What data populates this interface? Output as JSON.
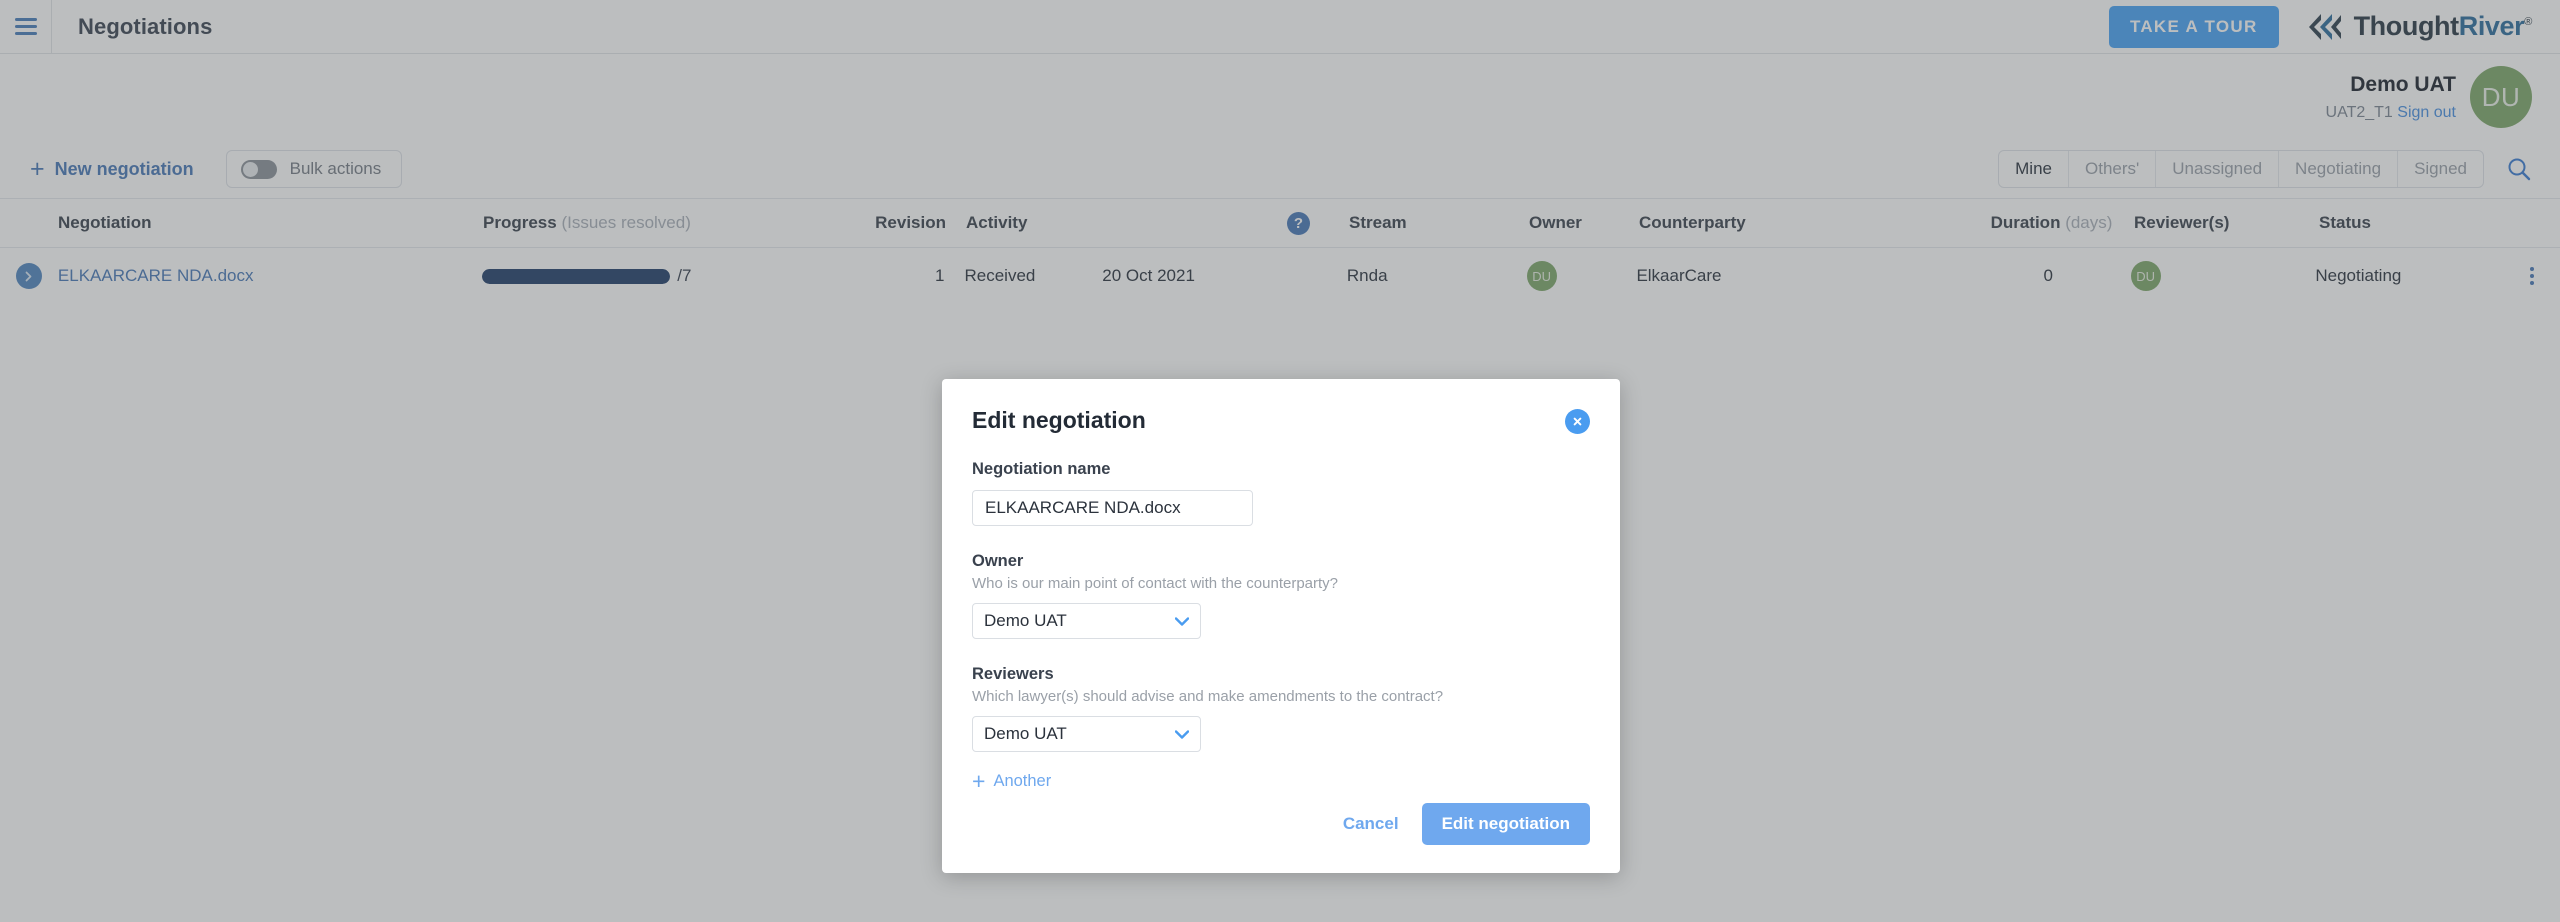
{
  "topbar": {
    "menu_icon": "hamburger-icon",
    "title": "Negotiations",
    "tour_button": "TAKE A TOUR",
    "logo_thought": "Thought",
    "logo_river": "River",
    "logo_tm": "®"
  },
  "user": {
    "name": "Demo UAT",
    "tenant": "UAT2_T1",
    "sign_out": "Sign out",
    "avatar_initials": "DU",
    "avatar_color": "#7fa86b"
  },
  "actions": {
    "new_negotiation": "New negotiation",
    "bulk_actions": "Bulk actions",
    "bulk_actions_on": false,
    "search_icon": "search-icon"
  },
  "filters": {
    "items": [
      "Mine",
      "Others'",
      "Unassigned",
      "Negotiating",
      "Signed"
    ],
    "active": "Mine"
  },
  "table": {
    "headers": {
      "negotiation": "Negotiation",
      "progress": "Progress",
      "progress_sub": "(Issues resolved)",
      "revision": "Revision",
      "activity": "Activity",
      "stream": "Stream",
      "owner": "Owner",
      "counterparty": "Counterparty",
      "duration": "Duration",
      "duration_sub": "(days)",
      "reviewers": "Reviewer(s)",
      "status": "Status",
      "help_icon": "help-circle-icon"
    },
    "rows": [
      {
        "expand_icon": "chevron-right-icon",
        "name": "ELKAARCARE NDA.docx",
        "progress_percent": 100,
        "progress_total": "/7",
        "revision": "1",
        "activity": "Received",
        "date": "20 Oct 2021",
        "stream": "Rnda",
        "owner_initials": "DU",
        "counterparty": "ElkaarCare",
        "duration": "0",
        "reviewer_initials": "DU",
        "status": "Negotiating",
        "more_icon": "kebab-menu-icon"
      }
    ]
  },
  "modal": {
    "title": "Edit negotiation",
    "close_icon": "close-circle-icon",
    "name_field": {
      "label": "Negotiation name",
      "value": "ELKAARCARE NDA.docx",
      "placeholder": "Negotiation name"
    },
    "owner_field": {
      "label": "Owner",
      "help": "Who is our main point of contact with the counterparty?",
      "value": "Demo UAT"
    },
    "reviewers_field": {
      "label": "Reviewers",
      "help": "Which lawyer(s) should advise and make amendments to the contract?",
      "value": "Demo UAT",
      "add_another": "Another"
    },
    "cancel": "Cancel",
    "submit": "Edit negotiation"
  },
  "colors": {
    "accent_blue": "#4a79b8",
    "primary_blue": "#6fa8ee",
    "tour_blue": "#4aa3f5",
    "progress_navy": "#22406b",
    "avatar_green": "#7fa86b"
  }
}
